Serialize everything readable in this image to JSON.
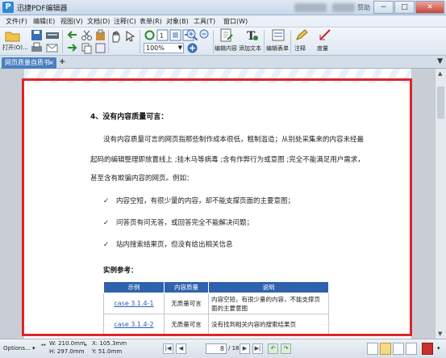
{
  "window": {
    "title": "迅捷PDF编辑器",
    "logo_letter": "P",
    "promo_text": "赞助",
    "buttons": {
      "minimize": "−",
      "maximize": "□",
      "close": "✕"
    }
  },
  "menu": [
    "文件(F)",
    "编辑(E)",
    "视图(V)",
    "文档(D)",
    "注释(C)",
    "表单(R)",
    "对象(B)",
    "工具(T)",
    "窗口(W)"
  ],
  "toolbar": {
    "open_label": "打开(O)...",
    "zoom_value": "100%",
    "edit_content_label": "编辑内容",
    "add_text_label": "添加文本",
    "edit_form_label": "编辑表单",
    "annotate_label": "注释",
    "measure_label": "度量"
  },
  "tabs": {
    "active_tab": "网页质量自质书",
    "close": "×",
    "add": "+",
    "menu": "▼"
  },
  "document": {
    "heading": "4、没有内容质量可言：",
    "paragraph_lines": [
      "没有内容质量可言的网页指那些制作成本很低，粗制滥造；从别处采集来的内容未经最",
      "起码的编辑整理即放置线上 ;挂木马等病毒 ;含有作弊行为或意图 ;完全不能满足用户需求，",
      "甚至含有欺骗内容的网页。例如："
    ],
    "bullets": [
      "内容空短，有很少量的内容，却不能支撑页面的主要意图；",
      "问答页有问无答，或回答完全不能解决问题；",
      "站内搜索结果页，但没有给出相关信息"
    ],
    "bullet_mark": "✓",
    "example_title": "实例参考：",
    "table": {
      "headers": [
        "示例",
        "内容质量",
        "说明"
      ],
      "rows": [
        {
          "example": "case 3.1.4-1",
          "quality": "无质量可言",
          "note": "内容空短，有很少量的内容，不能支撑页面的主要意图"
        },
        {
          "example": "case 3.1.4-2",
          "quality": "无质量可言",
          "note": "没有找到相关内容的搜索结果页"
        }
      ]
    }
  },
  "status": {
    "options": "Options...",
    "width": "W: 210.0mm",
    "height": "H: 297.0mm",
    "x": "X: 105.3mm",
    "y": "Y: 51.0mm",
    "current_page": "8",
    "total_pages": "/ 18"
  },
  "colors": {
    "accent": "#2f62ad",
    "highlight_border": "#e0242a",
    "active_tab": "#4a7fc0"
  }
}
